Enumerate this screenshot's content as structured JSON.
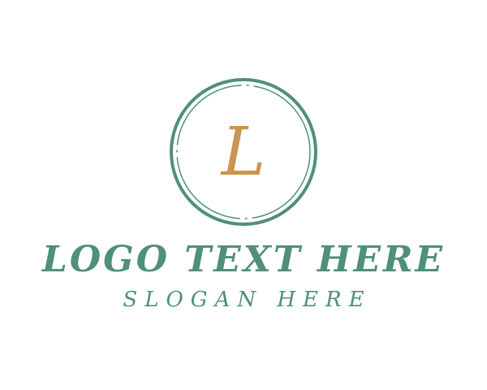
{
  "logo": {
    "monogram": "L",
    "brand_name": "LOGO TEXT HERE",
    "slogan": "SLOGAN HERE"
  },
  "colors": {
    "background": "#ffffff",
    "primary_green": "#4f8f7c",
    "monogram_gold": "#c9964f"
  }
}
